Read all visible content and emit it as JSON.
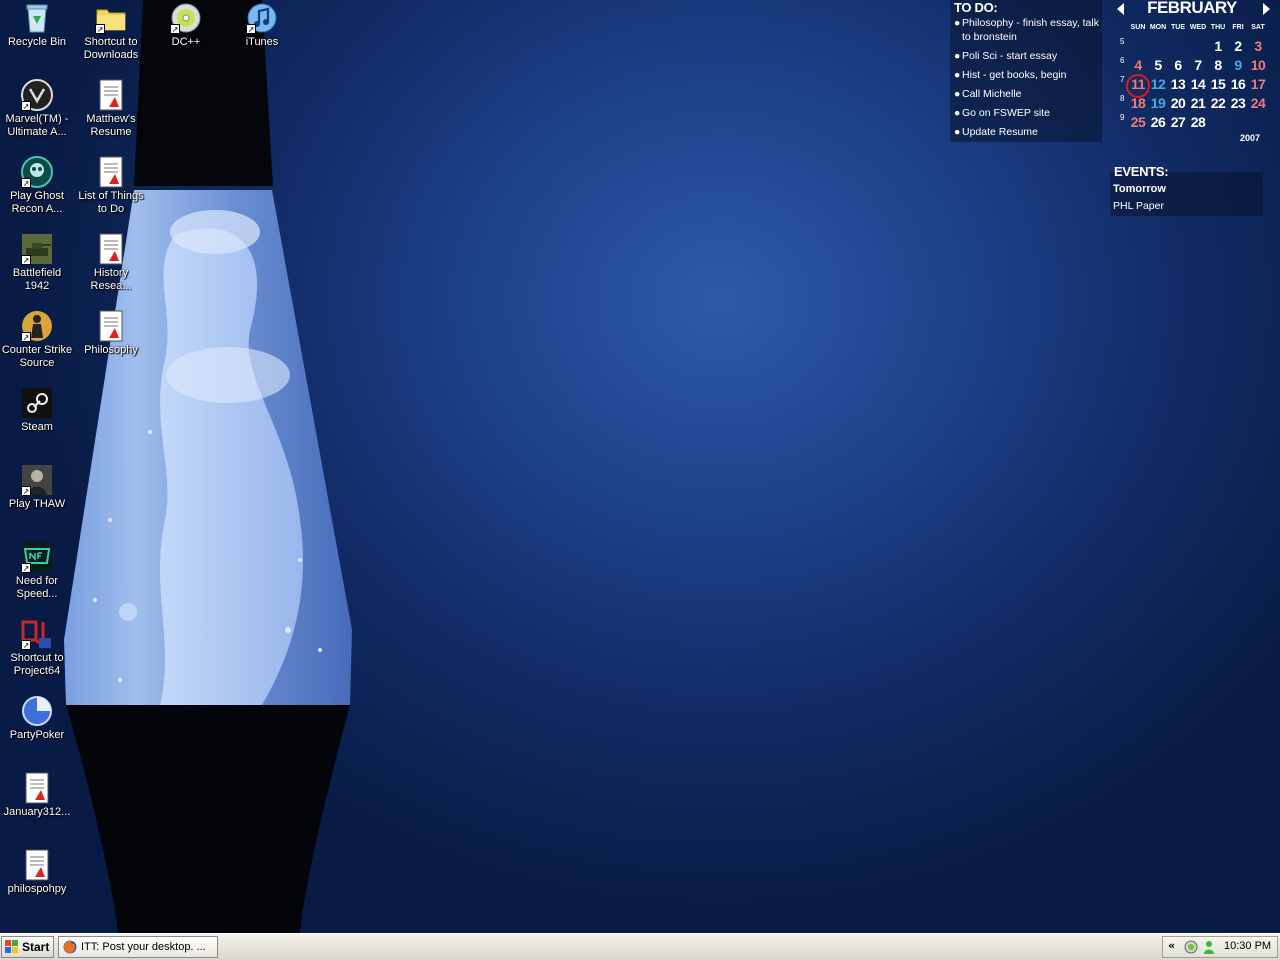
{
  "desktop": {
    "icons": [
      {
        "label": "Recycle Bin",
        "icon": "recycle-bin-icon",
        "shortcut": false
      },
      {
        "label": "Marvel(TM) - Ultimate A...",
        "icon": "shield-logo-icon",
        "shortcut": true
      },
      {
        "label": "Play Ghost Recon A...",
        "icon": "skull-icon",
        "shortcut": true
      },
      {
        "label": "Battlefield 1942",
        "icon": "tank-icon",
        "shortcut": true
      },
      {
        "label": "Counter Strike Source",
        "icon": "soldier-icon",
        "shortcut": true
      },
      {
        "label": "Steam",
        "icon": "steam-icon",
        "shortcut": false
      },
      {
        "label": "Play THAW",
        "icon": "portrait-icon",
        "shortcut": true
      },
      {
        "label": "Need for Speed...",
        "icon": "nfs-logo-icon",
        "shortcut": true
      },
      {
        "label": "Shortcut to Project64",
        "icon": "pj64-icon",
        "shortcut": true
      },
      {
        "label": "PartyPoker",
        "icon": "chip-icon",
        "shortcut": false
      },
      {
        "label": "January312...",
        "icon": "document-icon",
        "shortcut": false
      },
      {
        "label": "philospohpy",
        "icon": "document-icon",
        "shortcut": false
      },
      {
        "label": "Shortcut to Downloads",
        "icon": "folder-icon",
        "shortcut": true
      },
      {
        "label": "Matthew's Resume",
        "icon": "document-icon",
        "shortcut": false
      },
      {
        "label": "List of Things to Do",
        "icon": "document-icon",
        "shortcut": false
      },
      {
        "label": "History Resea...",
        "icon": "document-icon",
        "shortcut": false
      },
      {
        "label": "Philosophy",
        "icon": "document-icon",
        "shortcut": false
      },
      {
        "label": "DC++",
        "icon": "dcpp-icon",
        "shortcut": true
      },
      {
        "label": "iTunes",
        "icon": "itunes-icon",
        "shortcut": true
      }
    ]
  },
  "todo": {
    "title": "TO DO:",
    "items": [
      "Philosophy - finish essay, talk to bronstein",
      "Poli Sci - start essay",
      "Hist - get books, begin",
      "Call Michelle",
      "Go on FSWEP site",
      "Update Resume"
    ]
  },
  "calendar": {
    "month": "FEBRUARY",
    "year": "2007",
    "weekdays": [
      "SUN",
      "MON",
      "TUE",
      "WED",
      "THU",
      "FRI",
      "SAT"
    ],
    "week_numbers": [
      "5",
      "6",
      "7",
      "8",
      "9"
    ],
    "weeks": [
      [
        "",
        "",
        "",
        "",
        "1",
        "2",
        "3"
      ],
      [
        "4",
        "5",
        "6",
        "7",
        "8",
        "9",
        "10"
      ],
      [
        "11",
        "12",
        "13",
        "14",
        "15",
        "16",
        "17"
      ],
      [
        "18",
        "19",
        "20",
        "21",
        "22",
        "23",
        "24"
      ],
      [
        "25",
        "26",
        "27",
        "28",
        "",
        "",
        ""
      ]
    ],
    "highlighted_today": "11",
    "blue_days": [
      "9",
      "12",
      "19"
    ],
    "colors": {
      "weekend": "#f07a7a",
      "highlight": "#4aa8e8",
      "today_ring": "#e01818"
    }
  },
  "events": {
    "title": "EVENTS:",
    "when": "Tomorrow",
    "what": "PHL Paper"
  },
  "taskbar": {
    "start_label": "Start",
    "task_label": "ITT: Post your desktop. ...",
    "tray_chevron": "«",
    "clock": "10:30 PM"
  }
}
